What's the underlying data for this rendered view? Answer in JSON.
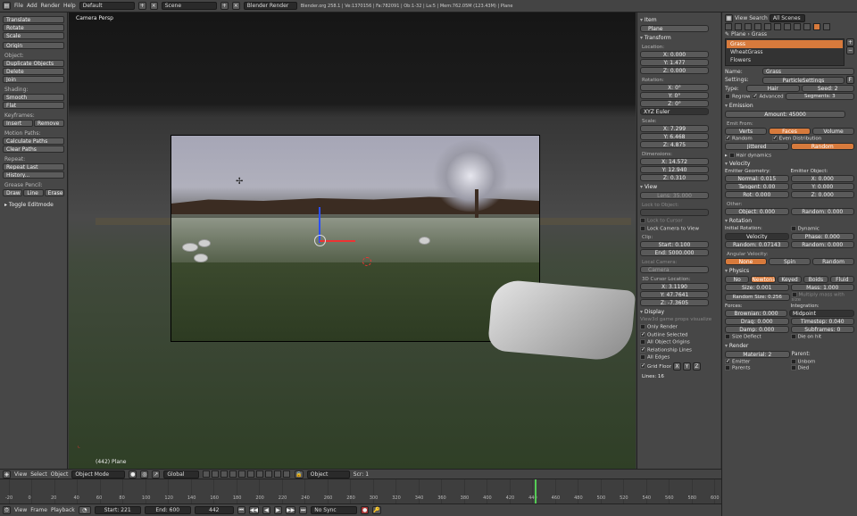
{
  "topbar": {
    "menus": [
      "File",
      "Add",
      "Render",
      "Help"
    ],
    "screen": "Default",
    "scene": "Scene",
    "engine": "Blender Render",
    "stats": "Blender.org 258.1 | Ve:1370156 | Fa:782091 | Ob:1-32 | La:5 | Mem:762.05M (123.43M) | Plane"
  },
  "toolshelf": {
    "transform": [
      "Translate",
      "Rotate",
      "Scale"
    ],
    "origin": "Origin",
    "object_label": "Object:",
    "object_tools": [
      "Duplicate Objects",
      "Delete",
      "Join"
    ],
    "shading_label": "Shading:",
    "shading": [
      "Smooth",
      "Flat"
    ],
    "keyframes_label": "Keyframes:",
    "keyframes": [
      "Insert",
      "Remove"
    ],
    "motion_label": "Motion Paths:",
    "motion": [
      "Calculate Paths",
      "Clear Paths"
    ],
    "repeat_label": "Repeat:",
    "repeat": [
      "Repeat Last",
      "History..."
    ],
    "grease_label": "Grease Pencil:",
    "grease": [
      "Draw",
      "Line",
      "Erase"
    ],
    "toggle": "Toggle Editmode"
  },
  "viewport": {
    "label": "Camera Persp",
    "object": "(442) Plane"
  },
  "npanel": {
    "item_header": "Item",
    "item_name": "Plane",
    "transform_header": "Transform",
    "location_label": "Location:",
    "location": [
      "X: 0.000",
      "Y: 1.477",
      "Z: 0.000"
    ],
    "rotation_label": "Rotation:",
    "rotation": [
      "X: 0°",
      "Y: 0°",
      "Z: 0°"
    ],
    "rot_mode": "XYZ Euler",
    "scale_label": "Scale:",
    "scale": [
      "X: 7.299",
      "Y: 6.468",
      "Z: 4.875"
    ],
    "dimensions_label": "Dimensions:",
    "dimensions": [
      "X: 14.572",
      "Y: 12.940",
      "Z: 0.310"
    ],
    "view_header": "View",
    "lens": "Lens: 35.000",
    "lock_label": "Lock to Object:",
    "lock_cursor": "Lock to Cursor",
    "lock_camera": "Lock Camera to View",
    "clip_label": "Clip:",
    "clip": [
      "Start: 0.100",
      "End: 5000.000"
    ],
    "local_camera_label": "Local Camera:",
    "camera": "Camera",
    "cursor_label": "3D Cursor Location:",
    "cursor": [
      "X: 3.1190",
      "Y: 47.7641",
      "Z: -7.3605"
    ],
    "display_header": "Display",
    "display_note": "View3d game props visualize",
    "display_checks": [
      {
        "label": "Only Render",
        "on": false
      },
      {
        "label": "Outline Selected",
        "on": true
      },
      {
        "label": "All Object Origins",
        "on": false
      },
      {
        "label": "Relationship Lines",
        "on": true
      },
      {
        "label": "All Edges",
        "on": false
      },
      {
        "label": "Grid Floor",
        "on": true
      }
    ],
    "axes": [
      "X",
      "Y",
      "Z"
    ],
    "lines": "Lines: 16"
  },
  "props": {
    "view": "View",
    "search": "Search",
    "scope": "All Scenes",
    "breadcrumb": [
      "Plane",
      "Grass"
    ],
    "systems": [
      "Grass",
      "WheatGrass",
      "Flowers"
    ],
    "name_label": "Name:",
    "name": "Grass",
    "settings_label": "Settings:",
    "settings": "ParticleSettings",
    "settings_users": "F",
    "type_label": "Type:",
    "type": "Hair",
    "seed": "Seed: 2",
    "regrow": "Regrow",
    "advanced": "Advanced",
    "segments": "Segments: 3",
    "emission_header": "Emission",
    "amount": "Amount: 45000",
    "emit_from_label": "Emit From:",
    "emit_from": [
      "Verts",
      "Faces",
      "Volume"
    ],
    "random_check": "Random",
    "even_check": "Even Distribution",
    "distribution": [
      "Jittered",
      "Random"
    ],
    "hair_dynamics": "Hair dynamics",
    "velocity_header": "Velocity",
    "emitter_geometry_label": "Emitter Geometry:",
    "emitter_geometry": [
      "Normal: 0.015",
      "Tangent: 0.00",
      "Rot: 0.000"
    ],
    "emitter_object_label": "Emitter Object:",
    "emitter_object": [
      "X: 0.000",
      "Y: 0.000",
      "Z: 0.000"
    ],
    "other_label": "Other:",
    "object_vel": "Object: 0.000",
    "random_vel": "Random: 0.000",
    "rotation_header": "Rotation",
    "initial_rotation_label": "Initial Rotation:",
    "dynamic": "Dynamic",
    "rot_mode": "Velocity",
    "phase": "Phase: 0.000",
    "random_rot": "Random: 0.07143",
    "random_phase": "Random: 0.000",
    "angular_label": "Angular Velocity:",
    "angular": [
      "None",
      "Spin",
      "Random"
    ],
    "physics_header": "Physics",
    "physics": [
      "No",
      "Newtonian",
      "Keyed",
      "Boids",
      "Fluid"
    ],
    "size": "Size: 0.001",
    "mass": "Mass: 1.000",
    "random_size": "Random Size: 0.256",
    "multiply_mass": "Multiply mass with size",
    "forces_label": "Forces:",
    "forces": [
      "Brownian: 0.000",
      "Drag: 0.000",
      "Damp: 0.000"
    ],
    "integration_label": "Integration:",
    "integration": "Midpoint",
    "timestep": "Timestep: 0.040",
    "subframes": "Subframes: 0",
    "size_deflect": "Size Deflect",
    "die_on_hit": "Die on hit",
    "render_header": "Render",
    "material": "Material: 2",
    "parent": "Parent:",
    "emitter": "Emitter",
    "unborn": "Unborn",
    "parents": "Parents",
    "died": "Died"
  },
  "viewheader": {
    "menus": [
      "View",
      "Select",
      "Object"
    ],
    "mode": "Object Mode",
    "orientation": "Global",
    "pivot": "Object",
    "layer": "Scr: 1"
  },
  "timeline": {
    "ticks": [
      "-20",
      "0",
      "20",
      "40",
      "60",
      "80",
      "100",
      "120",
      "140",
      "160",
      "180",
      "200",
      "220",
      "240",
      "260",
      "280",
      "300",
      "320",
      "340",
      "360",
      "380",
      "400",
      "420",
      "440",
      "460",
      "480",
      "500",
      "520",
      "540",
      "560",
      "580",
      "600"
    ],
    "current": 442,
    "menus": [
      "View",
      "Frame",
      "Playback"
    ],
    "start": "Start: 221",
    "end": "End: 600",
    "frame": "442",
    "sync": "No Sync"
  },
  "colors": {
    "accent": "#d77a3c",
    "panel": "#474747"
  }
}
